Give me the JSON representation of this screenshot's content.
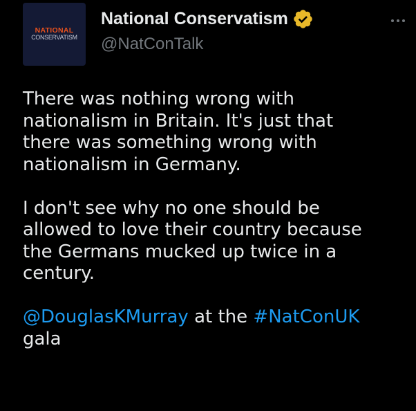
{
  "author": {
    "avatar_logo_line1": "NATIONAL",
    "avatar_logo_line2": "CONSERVATISM",
    "display_name": "National Conservatism",
    "handle": "@NatConTalk",
    "verified_badge_color": "#e8b829"
  },
  "tweet": {
    "paragraph1": [
      "There was nothing wrong with",
      "nationalism in Britain. It's just that",
      "there was something wrong with",
      "nationalism in Germany."
    ],
    "paragraph2": [
      "I don't see why no one should be",
      "allowed to love their country because",
      "the Germans mucked up twice in a",
      "century."
    ],
    "paragraph3": {
      "mention": "@DouglasKMurray",
      "text_between": " at the ",
      "hashtag": "#NatConUK",
      "last_line": "gala"
    }
  },
  "colors": {
    "background": "#000000",
    "text": "#e7e9ea",
    "secondary_text": "#71767b",
    "link": "#1d9bf0",
    "avatar_bg": "#141a35",
    "logo_accent": "#e9521e"
  },
  "icons": {
    "verified": "verified-badge-icon",
    "more": "more-horizontal-icon"
  }
}
